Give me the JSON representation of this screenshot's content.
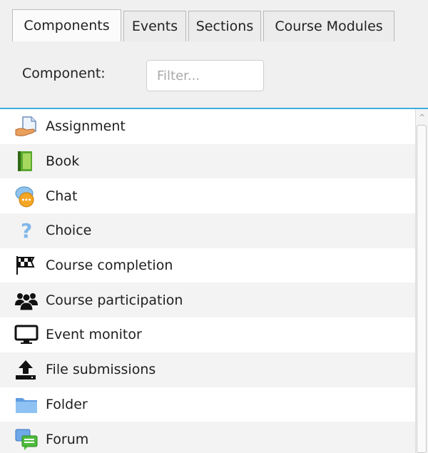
{
  "tabs": [
    {
      "label": "Components",
      "active": true
    },
    {
      "label": "Events",
      "active": false
    },
    {
      "label": "Sections",
      "active": false
    },
    {
      "label": "Course Modules",
      "active": false
    }
  ],
  "filter": {
    "label": "Component:",
    "placeholder": "Filter...",
    "value": ""
  },
  "components": [
    {
      "label": "Assignment",
      "icon": "assignment-icon"
    },
    {
      "label": "Book",
      "icon": "book-icon"
    },
    {
      "label": "Chat",
      "icon": "chat-icon"
    },
    {
      "label": "Choice",
      "icon": "question-icon"
    },
    {
      "label": "Course completion",
      "icon": "checkered-flag-icon"
    },
    {
      "label": "Course participation",
      "icon": "users-icon"
    },
    {
      "label": "Event monitor",
      "icon": "monitor-icon"
    },
    {
      "label": "File submissions",
      "icon": "upload-icon"
    },
    {
      "label": "Folder",
      "icon": "folder-icon"
    },
    {
      "label": "Forum",
      "icon": "forum-icon"
    }
  ],
  "colors": {
    "accent": "#3daee0",
    "tab_bar_bg": "#f0f0f0",
    "row_alt_bg": "#f3f3f3"
  }
}
